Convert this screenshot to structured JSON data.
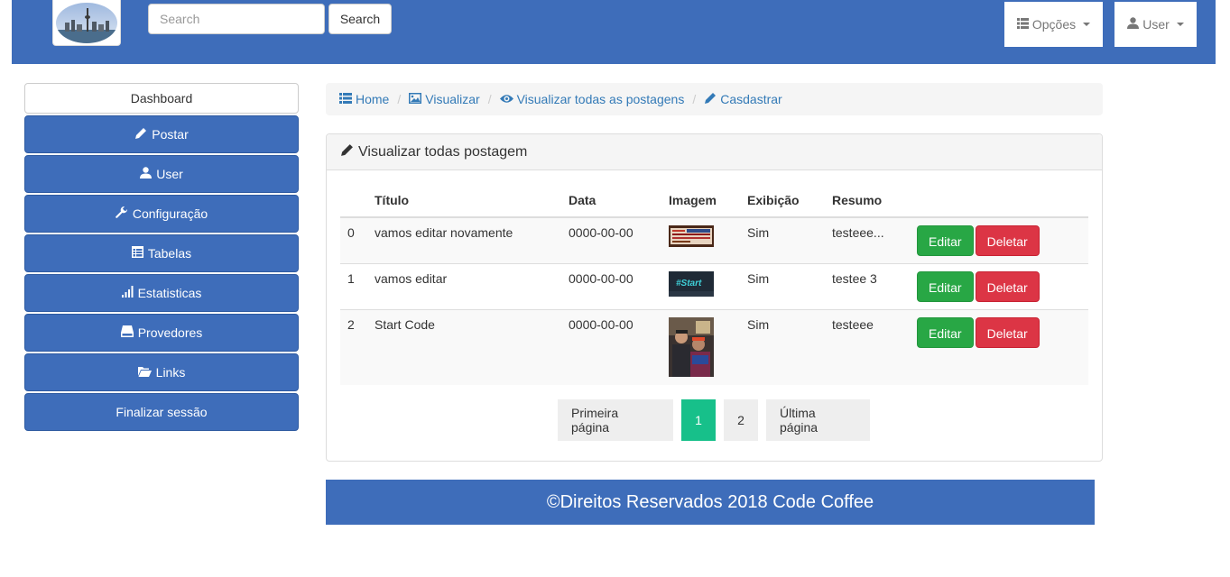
{
  "navbar": {
    "search_placeholder": "Search",
    "search_button": "Search",
    "options_label": "Opções",
    "user_label": "User"
  },
  "sidebar": {
    "items": [
      {
        "label": "Dashboard",
        "icon": "none"
      },
      {
        "label": "Postar",
        "icon": "pencil-icon"
      },
      {
        "label": "User",
        "icon": "user-icon"
      },
      {
        "label": "Configuração",
        "icon": "wrench-icon"
      },
      {
        "label": "Tabelas",
        "icon": "table-icon"
      },
      {
        "label": "Estatisticas",
        "icon": "signal-icon"
      },
      {
        "label": "Provedores",
        "icon": "hdd-icon"
      },
      {
        "label": "Links",
        "icon": "folder-open-icon"
      },
      {
        "label": "Finalizar sessão",
        "icon": "none"
      }
    ]
  },
  "breadcrumb": {
    "items": [
      "Home",
      "Visualizar",
      "Visualizar todas as postagens",
      "Casdastrar"
    ]
  },
  "panel": {
    "title": "Visualizar todas postagem",
    "columns": [
      "",
      "Título",
      "Data",
      "Imagem",
      "Exibição",
      "Resumo",
      ""
    ],
    "rows": [
      {
        "id": "0",
        "titulo": "vamos editar novamente",
        "data": "0000-00-00",
        "exibicao": "Sim",
        "resumo": "testeee...",
        "edit": "Editar",
        "delete": "Deletar"
      },
      {
        "id": "1",
        "titulo": "vamos editar",
        "data": "0000-00-00",
        "exibicao": "Sim",
        "resumo": "testee 3",
        "edit": "Editar",
        "delete": "Deletar"
      },
      {
        "id": "2",
        "titulo": "Start Code",
        "data": "0000-00-00",
        "exibicao": "Sim",
        "resumo": "testeee",
        "edit": "Editar",
        "delete": "Deletar"
      }
    ],
    "thumb_text_row1": "#Start"
  },
  "pagination": {
    "first": "Primeira página",
    "pages": [
      "1",
      "2"
    ],
    "active_page": "1",
    "last": "Última página"
  },
  "footer": {
    "text": "©Direitos Reservados 2018 Code Coffee"
  },
  "colors": {
    "primary": "#3e6dba",
    "success": "#28a745",
    "danger": "#dc3545",
    "page_active": "#17c08a"
  }
}
